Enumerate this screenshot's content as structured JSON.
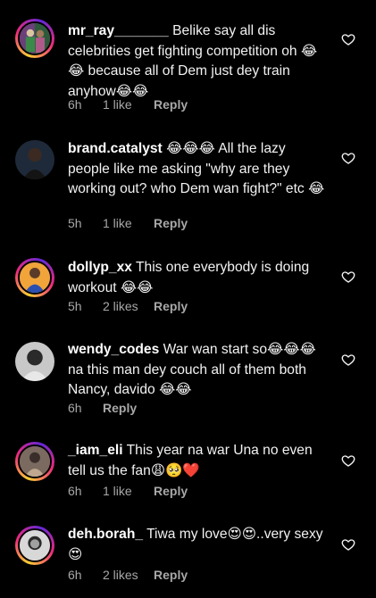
{
  "comments": [
    {
      "username": "mr_ray_______",
      "text": "Belike say all dis celebrities get fighting competition oh 😂😂 because all of Dem just dey train anyhow😂😂",
      "time": "6h",
      "likes": "1 like",
      "reply": "Reply",
      "avatar_icon": "profile-avatar",
      "avatar_colors": [
        "#6b3f7a",
        "#3a8a4a",
        "#d9c6a0"
      ]
    },
    {
      "username": "brand.catalyst",
      "text": "😂😂😂 All the lazy people like me asking \"why are they working out? who Dem wan fight?\" etc 😂",
      "time": "5h",
      "likes": "1 like",
      "reply": "Reply",
      "avatar_icon": "profile-avatar",
      "avatar_colors": [
        "#1e2a3a",
        "#141414",
        "#3a4a5c"
      ]
    },
    {
      "username": "dollyp_xx",
      "text": "This one everybody is doing workout 😂😂",
      "time": "5h",
      "likes": "2 likes",
      "reply": "Reply",
      "avatar_icon": "profile-avatar",
      "avatar_colors": [
        "#f0a43a",
        "#2a4fb0",
        "#5a3b2a"
      ]
    },
    {
      "username": "wendy_codes",
      "text": "War wan start so😂😂😂 na this man dey couch all of them both Nancy, davido 😂😂",
      "time": "6h",
      "likes": "",
      "reply": "Reply",
      "avatar_icon": "profile-avatar",
      "avatar_colors": [
        "#c8c8c8",
        "#2a2a2a",
        "#e8e8e8"
      ]
    },
    {
      "username": "_iam_eli",
      "text": "This year na war Una no even tell us the fan😩🥺❤️",
      "time": "6h",
      "likes": "1 like",
      "reply": "Reply",
      "avatar_icon": "profile-avatar",
      "avatar_colors": [
        "#7a6a60",
        "#3a2e2a",
        "#c0a890"
      ]
    },
    {
      "username": "deh.borah_",
      "text": "Tiwa my love😍😍..very sexy😍",
      "time": "6h",
      "likes": "2 likes",
      "reply": "Reply",
      "avatar_icon": "profile-avatar",
      "avatar_colors": [
        "#d8d8d8",
        "#2a2a2a",
        "#a0a0a0"
      ]
    }
  ],
  "heart_icon": "heart-outline-icon",
  "colors": {
    "background": "#000000",
    "text": "#f2f2f2",
    "meta": "#a8a8a8"
  }
}
